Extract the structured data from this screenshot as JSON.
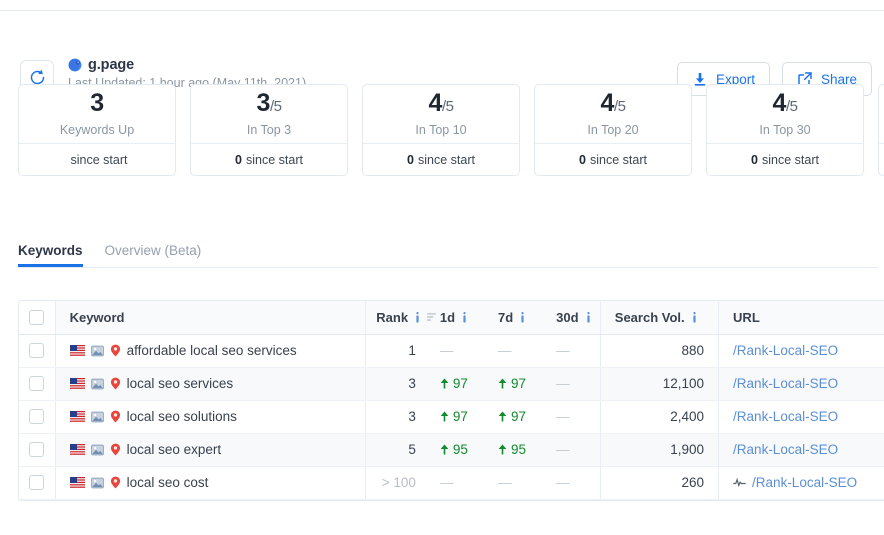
{
  "header": {
    "refresh_icon": "refresh-circle-icon",
    "favicon": "globe-favicon",
    "site_name": "g.page",
    "last_updated": "Last Updated: 1 hour ago (May 11th, 2021)",
    "actions": [
      {
        "label": "Export",
        "icon": "download-icon"
      },
      {
        "label": "Share",
        "icon": "external-link-icon"
      }
    ]
  },
  "stat_cards": [
    {
      "value": "3",
      "denominator": "",
      "label": "Keywords Up",
      "delta": "",
      "delta_suffix": "since start"
    },
    {
      "value": "3",
      "denominator": "/5",
      "label": "In Top 3",
      "delta": "0",
      "delta_suffix": "since start"
    },
    {
      "value": "4",
      "denominator": "/5",
      "label": "In Top 10",
      "delta": "0",
      "delta_suffix": "since start"
    },
    {
      "value": "4",
      "denominator": "/5",
      "label": "In Top 20",
      "delta": "0",
      "delta_suffix": "since start"
    },
    {
      "value": "4",
      "denominator": "/5",
      "label": "In Top 30",
      "delta": "0",
      "delta_suffix": "since start"
    },
    {
      "value": "",
      "denominator": "",
      "label": "",
      "delta": "",
      "delta_suffix": ""
    }
  ],
  "tabs": [
    {
      "label": "Keywords",
      "active": true
    },
    {
      "label": "Overview (Beta)",
      "active": false
    }
  ],
  "table": {
    "columns": [
      {
        "key": "checkbox",
        "label": "",
        "info": false,
        "sort": false
      },
      {
        "key": "keyword",
        "label": "Keyword",
        "info": false,
        "sort": false
      },
      {
        "key": "rank",
        "label": "Rank",
        "info": true,
        "sort": true
      },
      {
        "key": "d1",
        "label": "1d",
        "info": true,
        "sort": false
      },
      {
        "key": "d7",
        "label": "7d",
        "info": true,
        "sort": false
      },
      {
        "key": "d30",
        "label": "30d",
        "info": true,
        "sort": false
      },
      {
        "key": "vol",
        "label": "Search Vol.",
        "info": true,
        "sort": false
      },
      {
        "key": "url",
        "label": "URL",
        "info": false,
        "sort": false
      }
    ],
    "rows": [
      {
        "keyword": "affordable local seo services",
        "flag": "us-flag-icon",
        "image_icon": "image-icon",
        "pin_icon": "map-pin-icon",
        "rank": "1",
        "rank_dim": false,
        "d1": "",
        "d7": "",
        "d30": "",
        "vol": "880",
        "url": "/Rank-Local-SEO",
        "url_icon": ""
      },
      {
        "keyword": "local seo services",
        "flag": "us-flag-icon",
        "image_icon": "image-icon",
        "pin_icon": "map-pin-icon",
        "rank": "3",
        "rank_dim": false,
        "d1": "97",
        "d7": "97",
        "d30": "",
        "vol": "12,100",
        "url": "/Rank-Local-SEO",
        "url_icon": ""
      },
      {
        "keyword": "local seo solutions",
        "flag": "us-flag-icon",
        "image_icon": "image-icon",
        "pin_icon": "map-pin-icon",
        "rank": "3",
        "rank_dim": false,
        "d1": "97",
        "d7": "97",
        "d30": "",
        "vol": "2,400",
        "url": "/Rank-Local-SEO",
        "url_icon": ""
      },
      {
        "keyword": "local seo expert",
        "flag": "us-flag-icon",
        "image_icon": "image-icon",
        "pin_icon": "map-pin-icon",
        "rank": "5",
        "rank_dim": false,
        "d1": "95",
        "d7": "95",
        "d30": "",
        "vol": "1,900",
        "url": "/Rank-Local-SEO",
        "url_icon": ""
      },
      {
        "keyword": "local seo cost",
        "flag": "us-flag-icon",
        "image_icon": "image-icon",
        "pin_icon": "map-pin-icon",
        "rank": "> 100",
        "rank_dim": true,
        "d1": "",
        "d7": "",
        "d30": "",
        "vol": "260",
        "url": "/Rank-Local-SEO",
        "url_icon": "activity-pulse-icon"
      }
    ],
    "empty_cell": "—",
    "delta_direction": "up"
  },
  "colors": {
    "accent_blue": "#1a73e8",
    "link_blue": "#5b8fd4",
    "up_green": "#148a2e",
    "pin_red": "#e8453c",
    "border": "#e3e9f0",
    "row_alt": "#f7f9fb",
    "header_bg": "#f8fafc",
    "text_dark": "#39424e",
    "text_muted": "#8a96a3"
  }
}
